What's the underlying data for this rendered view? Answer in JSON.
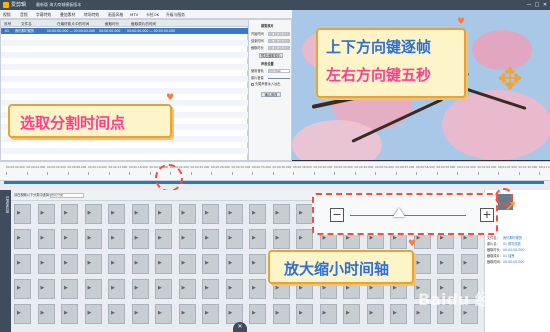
{
  "titlebar": {
    "app_name": "爱剪辑",
    "menu_text": "最新版  海大商城模板版本",
    "minimize": "—",
    "maximize": "□",
    "close": "✕"
  },
  "toolbar": {
    "tabs": [
      "视频",
      "音频",
      "字幕特效",
      "叠加素材",
      "转场特效",
      "画面风格",
      "MTV",
      "卡拉OK",
      "升级与服务"
    ]
  },
  "clip_table": {
    "headers": [
      "序号",
      "文件名",
      "在最终影片中的时间",
      "截取时长",
      "截取原片的时间"
    ],
    "selected_row": {
      "index": "01",
      "name": "我们那时候的",
      "time": "00:00:00.000 — 00:00:00.000",
      "duration": "00:00:00.000",
      "source": "00:00:00.000 — 00:00:00.000"
    }
  },
  "props": {
    "section1": "裁剪原片",
    "start_label": "开始时间",
    "start_value": "00:00:00.000",
    "end_label": "结束时间",
    "end_value": "00:00:00.000",
    "duration_label": "截取时长",
    "duration_value": "00:00:00.000",
    "preview_btn": "预览/截取原片",
    "section2": "声音设置",
    "sound_label": "使用音轨",
    "sound_value": "原片音轨",
    "volume_label": "原片音量",
    "checkbox_label": "头尾声音淡入淡出",
    "confirm_btn": "确认修改"
  },
  "callouts": {
    "select_point": "选取分割时间点",
    "frame_step_line1": "上下方向键逐帧",
    "frame_step_line2": "左右方向键五秒",
    "zoom_timeline": "放大缩小时间轴"
  },
  "timeline": {
    "ticks": [
      "00:00:00.000",
      "00:00:02.000",
      "00:00:05.000",
      "00:00:08.000",
      "00:00:10.000",
      "00:00:13.000",
      "00:00:16.000",
      "00:00:20.000",
      "00:00:22.000",
      "00:00:25.000",
      "00:00:28.000",
      "00:00:30.000",
      "00:00:33.000",
      "00:00:36.000",
      "00:00:38.000",
      "00:00:40.000",
      "00:00:43.000",
      "00:00:46.000",
      "00:00:50.000",
      "00:00:53.000",
      "00:00:56.000",
      "00:00:58.000",
      "00:01:01.000",
      "00:01:04.000",
      "00:01:07.000",
      "00:01:10.000",
      "00:01:13.000"
    ]
  },
  "bottom": {
    "clip_label": "请在视频以下分类中选择：",
    "clip_select": "所有分类",
    "sidebar_label": "已添加片段",
    "info_labels": [
      "文件名：",
      "原片名：",
      "截取时长：",
      "截取原片：",
      "截取时间："
    ],
    "info_values": [
      "我们那时候的",
      "01 鲜花绽放",
      "00:00:00.000",
      "01 摇曳",
      "00:00:00.000"
    ]
  },
  "zoom": {
    "minus": "−",
    "plus": "+",
    "level": 0.42
  },
  "watermark": "Baidu 经验",
  "colors": {
    "accent_blue": "#2e74c9",
    "callout_orange": "#e8a23a",
    "callout_pink": "#ff3f8e",
    "callout_blue": "#2f6fd6",
    "dash_red": "#ff4b3a"
  }
}
